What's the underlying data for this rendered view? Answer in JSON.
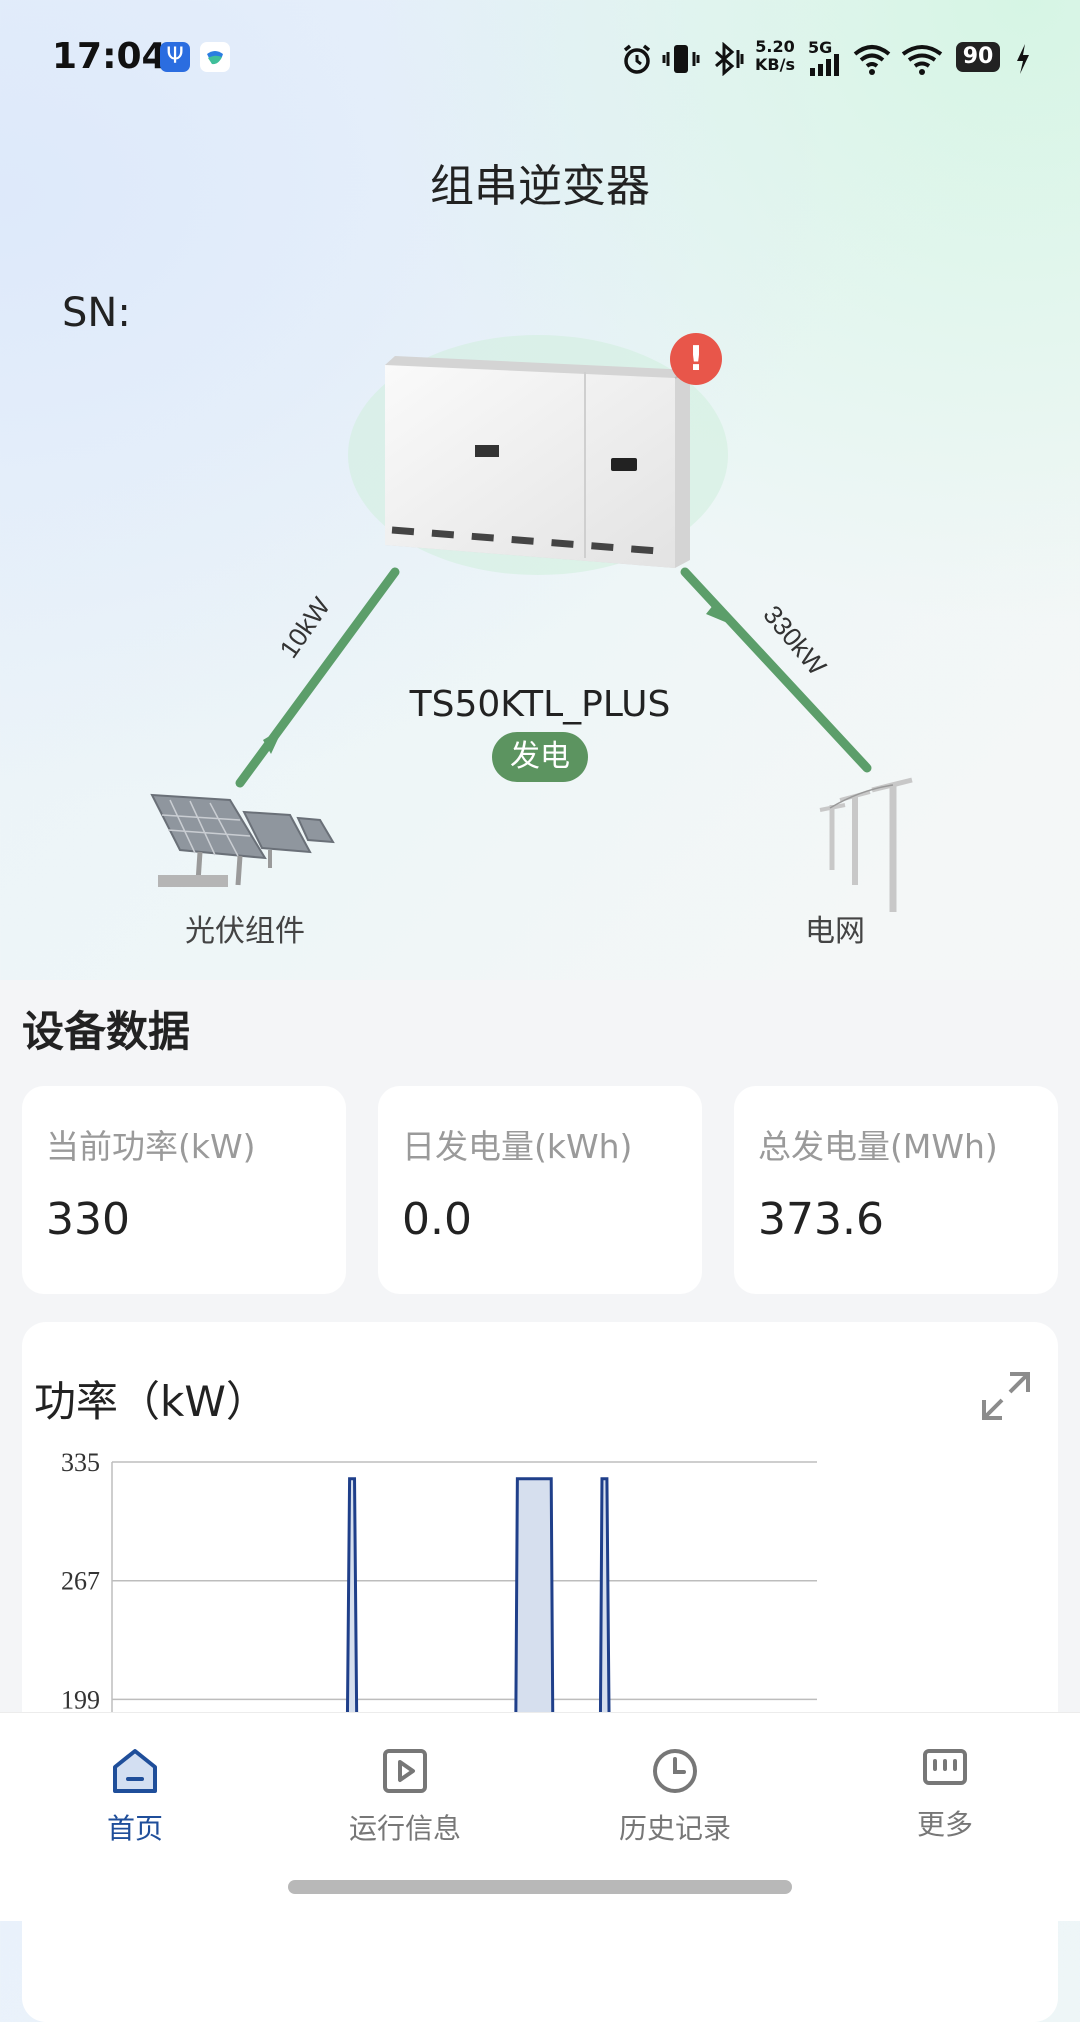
{
  "status_bar": {
    "time": "17:04",
    "net_speed_value": "5.20",
    "net_speed_unit": "KB/s",
    "network": "5G",
    "battery": "90"
  },
  "header": {
    "title": "组串逆变器"
  },
  "device": {
    "sn_label": "SN:",
    "model": "TS50KTL_PLUS",
    "status": "发电",
    "pv_power_label": "10kW",
    "grid_power_label": "330kW",
    "pv_label": "光伏组件",
    "grid_label": "电网",
    "alert_symbol": "!"
  },
  "section": {
    "title": "设备数据"
  },
  "cards": [
    {
      "label": "当前功率(kW)",
      "value": "330"
    },
    {
      "label": "日发电量(kWh)",
      "value": "0.0"
    },
    {
      "label": "总发电量(MWh)",
      "value": "373.6"
    }
  ],
  "chart": {
    "title": "功率（kW）"
  },
  "chart_data": {
    "type": "area",
    "title": "功率（kW）",
    "xlabel": "",
    "ylabel": "",
    "yticks": [
      335,
      267,
      199
    ],
    "ylim": [
      199,
      335
    ],
    "grid": true,
    "series": [
      {
        "x": [
          0,
          0.33,
          0.337,
          0.344,
          0.351,
          0.57,
          0.575,
          0.623,
          0.628,
          0.69,
          0.695,
          0.702,
          0.709,
          1
        ],
        "values": [
          0,
          0,
          330,
          330,
          0,
          0,
          330,
          330,
          0,
          0,
          330,
          330,
          0,
          0
        ]
      }
    ],
    "colors": {
      "line": "#1f3f8a",
      "fill": "#d6dfee",
      "grid": "#bdbdbd"
    }
  },
  "tabs": [
    {
      "label": "首页",
      "icon": "home-icon",
      "active": true
    },
    {
      "label": "运行信息",
      "icon": "play-icon",
      "active": false
    },
    {
      "label": "历史记录",
      "icon": "clock-icon",
      "active": false
    },
    {
      "label": "更多",
      "icon": "more-icon",
      "active": false
    }
  ],
  "colors": {
    "accent": "#1f4e9a",
    "flow_green": "#5c9e6a",
    "status_green": "#5c9460",
    "alert_red": "#e8564a"
  }
}
